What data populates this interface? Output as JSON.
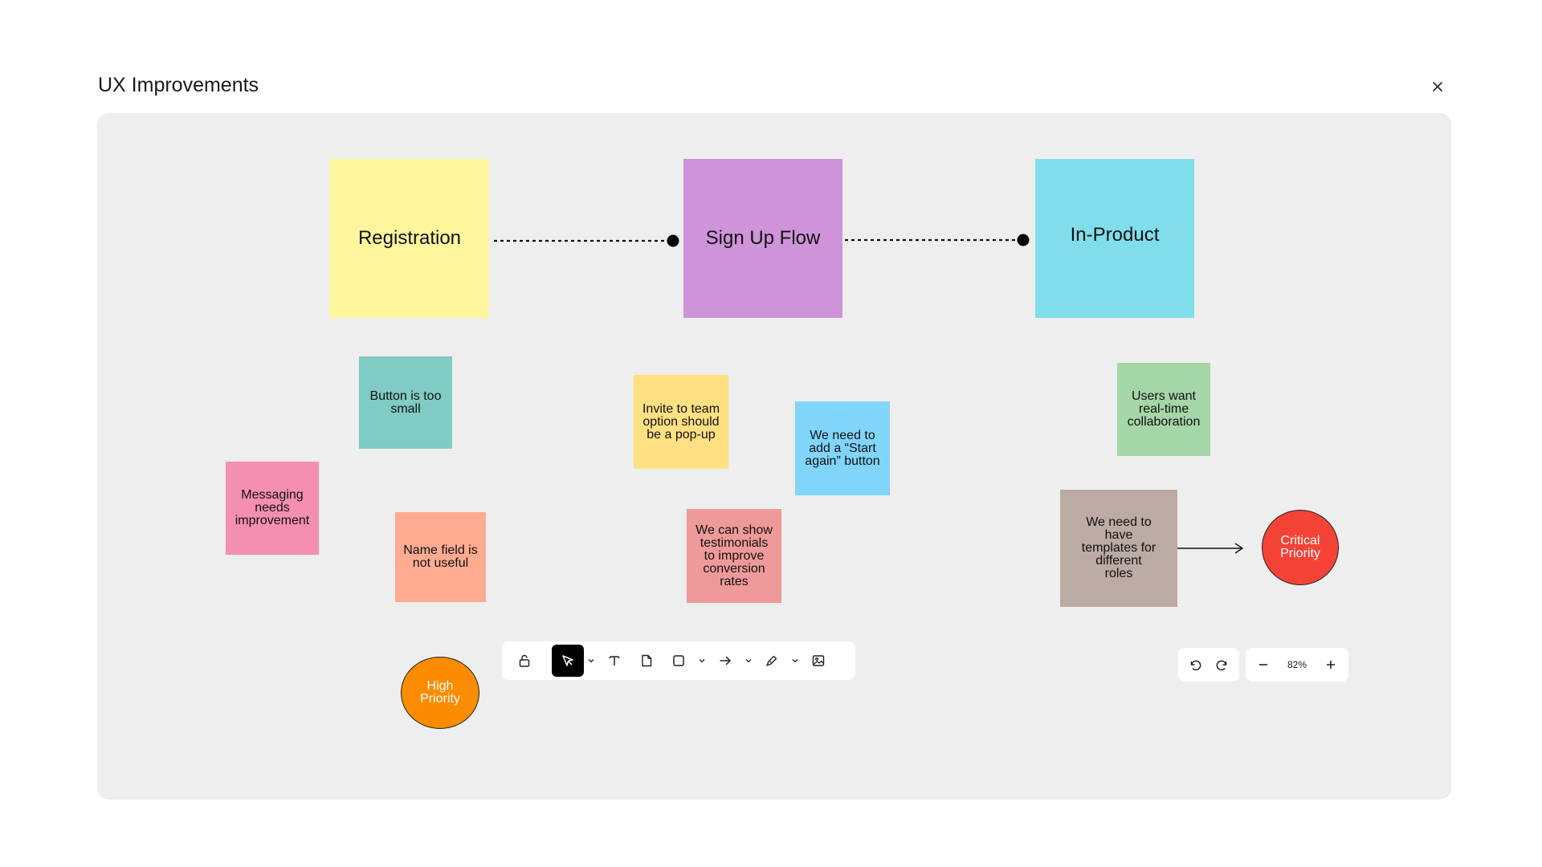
{
  "header": {
    "title": "UX Improvements",
    "close_icon": "close-icon"
  },
  "board": {
    "categories": [
      {
        "label": "Registration",
        "color": "#fff59d"
      },
      {
        "label": "Sign Up Flow",
        "color": "#ce93d8"
      },
      {
        "label": "In-Product",
        "color": "#80deea"
      }
    ],
    "notes": [
      {
        "lines": [
          "Button is too",
          "small"
        ],
        "color": "#80cbc4"
      },
      {
        "lines": [
          "Messaging",
          "needs",
          "improvement"
        ],
        "color": "#f48fb1"
      },
      {
        "lines": [
          "Name field is",
          "not useful"
        ],
        "color": "#ffab91"
      },
      {
        "lines": [
          "Invite to team",
          "option should",
          "be a pop-up"
        ],
        "color": "#ffe082"
      },
      {
        "lines": [
          "We need to",
          "add a “Start",
          "again” button"
        ],
        "color": "#81d4fa"
      },
      {
        "lines": [
          "We can show",
          "testimonials",
          "to improve",
          "conversion",
          "rates"
        ],
        "color": "#ef9a9a"
      },
      {
        "lines": [
          "Users want",
          "real-time",
          "collaboration"
        ],
        "color": "#a5d6a7"
      },
      {
        "lines": [
          "We need to",
          "have",
          "templates for",
          "different",
          "roles"
        ],
        "color": "#bcaaa4"
      }
    ],
    "priorities": [
      {
        "lines": [
          "High",
          "Priority"
        ],
        "color": "#fb8c00"
      },
      {
        "lines": [
          "Critical",
          "Priority"
        ],
        "color": "#f44336"
      }
    ]
  },
  "toolbar": {
    "tools": [
      "lock-icon",
      "select-icon",
      "text-icon",
      "sticky-note-icon",
      "shape-icon",
      "arrow-icon",
      "pen-icon",
      "image-icon"
    ],
    "active_tool": "select-icon"
  },
  "zoom": {
    "level": "82%",
    "undo_icon": "undo-icon",
    "redo_icon": "redo-icon",
    "zoom_out_icon": "minus-icon",
    "zoom_in_icon": "plus-icon"
  }
}
